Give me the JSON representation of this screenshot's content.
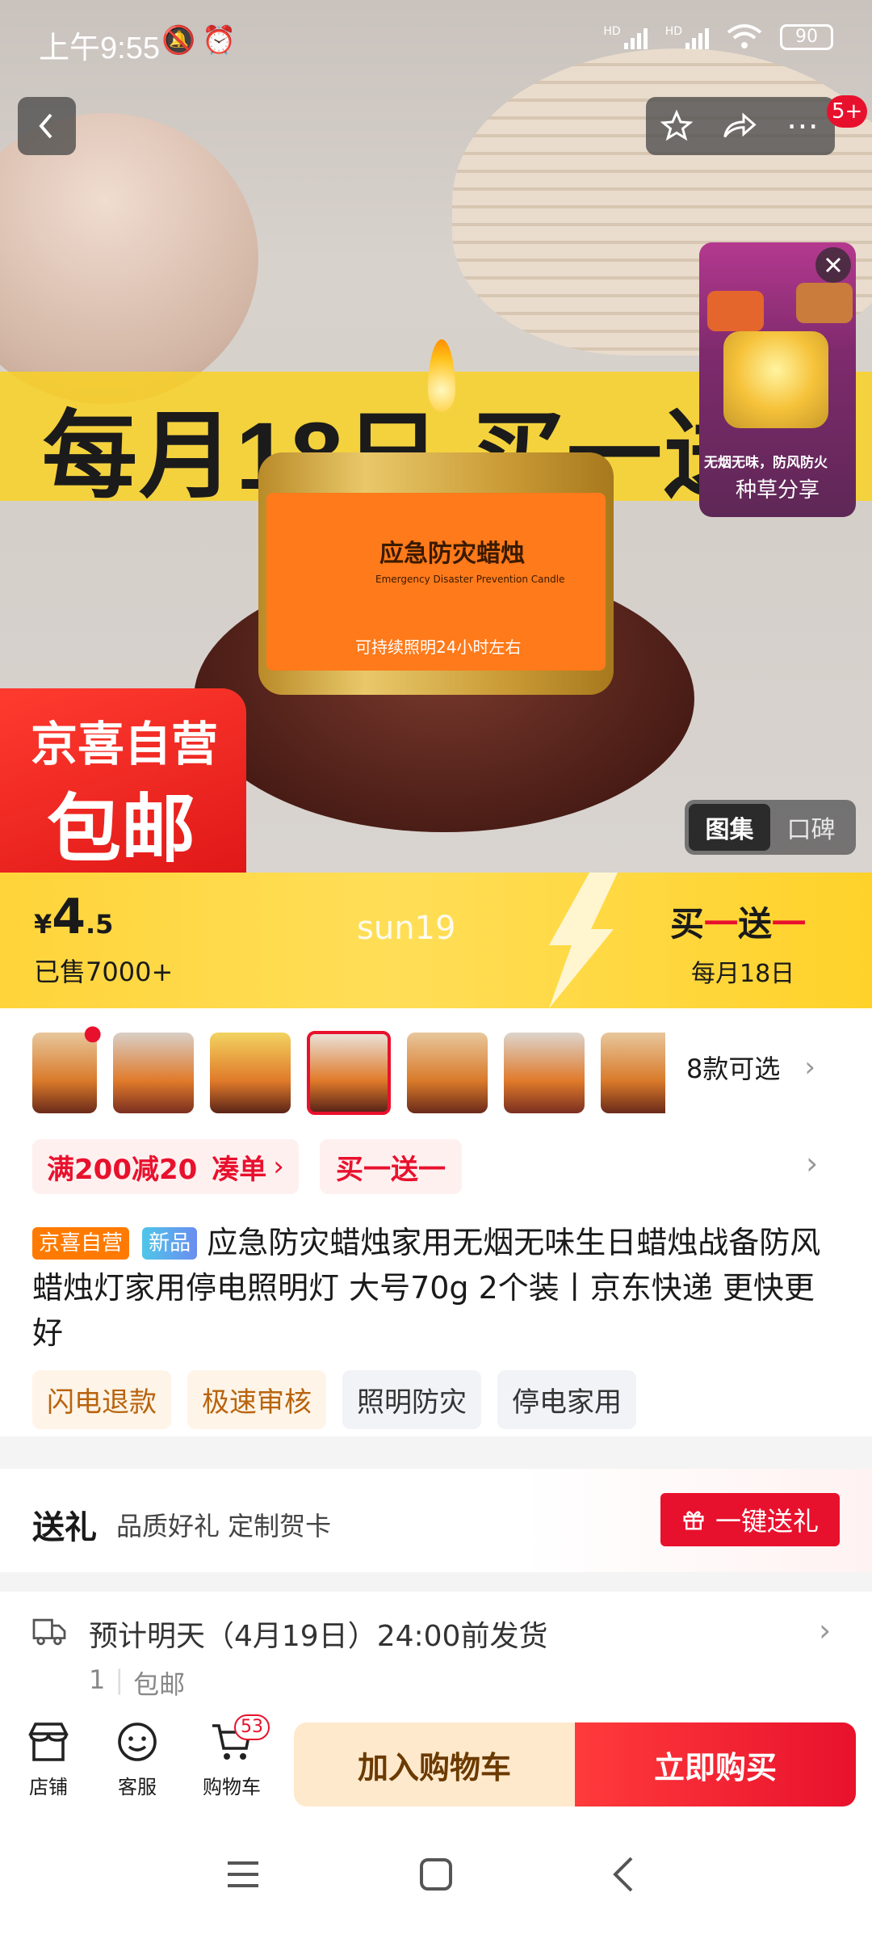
{
  "status_bar": {
    "time": "上午9:55",
    "battery": "90",
    "hd1": "HD",
    "hd2": "HD"
  },
  "hero": {
    "badge_count": "5+",
    "banner_text": "每月18日 买一送",
    "candle_label_title": "应急防灾蜡烛",
    "candle_label_en": "Emergency Disaster Prevention Candle",
    "candle_label_bottom": "可持续照明24小时左右",
    "promo_line1": "京喜自营",
    "promo_line2": "包邮",
    "mini_video_caption": "无烟无味，防风防火",
    "mini_video_label": "种草分享",
    "gallery_tabs": [
      "图集",
      "口碑"
    ]
  },
  "price_banner": {
    "currency": "¥",
    "price_int": "4",
    "price_dec": ".5",
    "sold": "已售7000+",
    "watermark": "sun19",
    "promo_buy": "买",
    "promo_one1": "一",
    "promo_send": "送",
    "promo_one2": "一",
    "promo_sub": "每月18日"
  },
  "variants": {
    "count_label": "8款可选",
    "thumbs": [
      "v1",
      "v2",
      "v3",
      "v4",
      "v5",
      "v6",
      "v7"
    ]
  },
  "coupons": {
    "c1_main": "满200减20",
    "c1_link": "凑单",
    "c2": "买一送一"
  },
  "product": {
    "tag_self": "京喜自营",
    "tag_new": "新品",
    "title": "应急防灾蜡烛家用无烟无味生日蜡烛战备防风蜡烛灯家用停电照明灯 大号70g 2个装丨京东快递 更快更好",
    "service_tags": [
      "闪电退款",
      "极速审核",
      "照明防灾",
      "停电家用"
    ]
  },
  "gift": {
    "title": "送礼",
    "desc": "品质好礼 定制贺卡",
    "button": "一键送礼"
  },
  "delivery": {
    "text": "预计明天（4月19日）24:00前发货",
    "qty": "1",
    "shipping": "包邮"
  },
  "footer": {
    "shop": "店铺",
    "service": "客服",
    "cart": "购物车",
    "cart_count": "53",
    "add_cart": "加入购物车",
    "buy_now": "立即购买"
  },
  "colors": {
    "accent_red": "#e8112d",
    "banner_yellow": "#ffd43a",
    "tag_orange": "#ff7a00"
  }
}
